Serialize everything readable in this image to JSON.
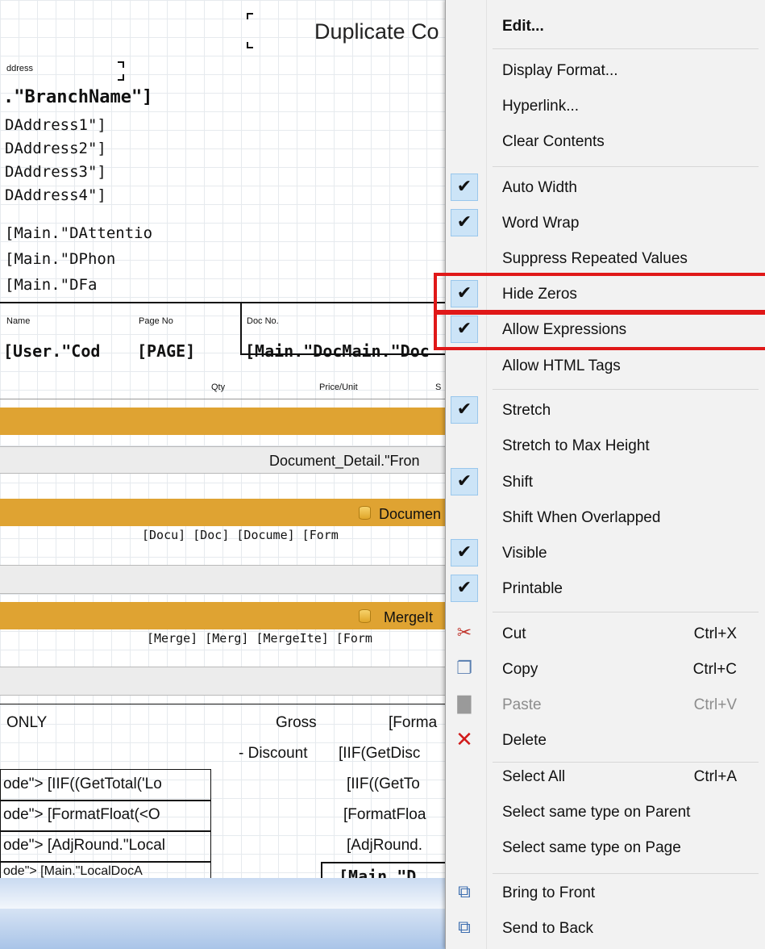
{
  "report": {
    "title": "Duplicate Co",
    "address_label": "ddress",
    "branch_name": ".\"BranchName\"]",
    "address_lines": [
      "DAddress1\"]",
      "DAddress2\"]",
      "DAddress3\"]",
      "DAddress4\"]"
    ],
    "attention": "[Main.\"DAttentio",
    "phone": "[Main.\"DPhon",
    "fax": "[Main.\"DFa",
    "name_label": "Name",
    "page_no_label": "Page No",
    "doc_no_label": "Doc No.",
    "user_code": "[User.\"Cod",
    "page_field": "[PAGE]",
    "doc_field": "[Main.\"DocMain.\"Doc",
    "qty_label": "Qty",
    "price_label": "Price/Unit",
    "s_label": "S",
    "detail_band": "Document_Detail.\"Fron",
    "document_band": "Documen",
    "detail_fields": "[Docu] [Doc] [Docume] [Form",
    "merge_band": "MergeIt",
    "merge_fields": "[Merge] [Merg] [MergeIte] [Form",
    "only_label": "ONLY",
    "gross_label": "Gross",
    "format_field": "[Forma",
    "discount_label": "- Discount",
    "iif_disc": "[IIF(GetDisc",
    "rows_left": [
      "ode\"> [IIF((GetTotal('Lo",
      "ode\"> [FormatFloat(<O",
      "ode\"> [AdjRound.\"Local",
      "ode\"> [Main.\"LocalDocA"
    ],
    "rows_right": [
      "[IIF((GetTo",
      "[FormatFloa",
      "[AdjRound.",
      "[Main.\"D"
    ]
  },
  "menu": {
    "items": [
      {
        "label": "Edit...",
        "bold": true,
        "checked": false
      },
      {
        "label": "Display Format...",
        "checked": false
      },
      {
        "label": "Hyperlink...",
        "checked": false
      },
      {
        "label": "Clear Contents",
        "checked": false
      },
      {
        "label": "Auto Width",
        "checked": true
      },
      {
        "label": "Word Wrap",
        "checked": true
      },
      {
        "label": "Suppress Repeated Values",
        "checked": false
      },
      {
        "label": "Hide Zeros",
        "checked": true
      },
      {
        "label": "Allow Expressions",
        "checked": true
      },
      {
        "label": "Allow HTML Tags",
        "checked": false
      },
      {
        "label": "Stretch",
        "checked": true
      },
      {
        "label": "Stretch to Max Height",
        "checked": false
      },
      {
        "label": "Shift",
        "checked": true
      },
      {
        "label": "Shift When Overlapped",
        "checked": false
      },
      {
        "label": "Visible",
        "checked": true
      },
      {
        "label": "Printable",
        "checked": true
      },
      {
        "label": "Cut",
        "shortcut": "Ctrl+X",
        "icon": "scissors-icon"
      },
      {
        "label": "Copy",
        "shortcut": "Ctrl+C",
        "icon": "copy-icon"
      },
      {
        "label": "Paste",
        "shortcut": "Ctrl+V",
        "icon": "paste-icon",
        "disabled": true
      },
      {
        "label": "Delete",
        "icon": "delete-x-icon"
      },
      {
        "label": "Select All",
        "shortcut": "Ctrl+A"
      },
      {
        "label": "Select same type on Parent"
      },
      {
        "label": "Select same type on Page"
      },
      {
        "label": "Bring to Front",
        "icon": "bring-to-front-icon"
      },
      {
        "label": "Send to Back",
        "icon": "send-to-back-icon"
      }
    ],
    "highlight_color": "#e01818",
    "check_color": "#cce4f7"
  }
}
